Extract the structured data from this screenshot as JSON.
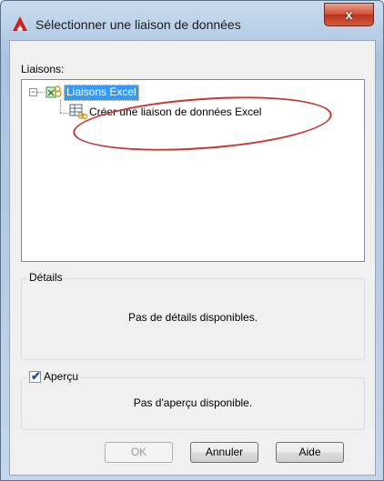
{
  "window": {
    "title": "Sélectionner une liaison de données",
    "close_glyph": "x"
  },
  "tree": {
    "label": "Liaisons:",
    "root": {
      "label": "Liaisons Excel",
      "expander": "−",
      "icon": "excel-links-icon"
    },
    "child": {
      "label": "Créer une liaison de données Excel",
      "icon": "data-link-icon"
    }
  },
  "details": {
    "title": "Détails",
    "text": "Pas de détails disponibles."
  },
  "preview": {
    "title": "Aperçu",
    "checked": true,
    "text": "Pas d'aperçu disponible."
  },
  "buttons": {
    "ok": "OK",
    "cancel": "Annuler",
    "help": "Aide"
  },
  "colors": {
    "selection": "#3399ff",
    "annotation": "#c23a32"
  }
}
